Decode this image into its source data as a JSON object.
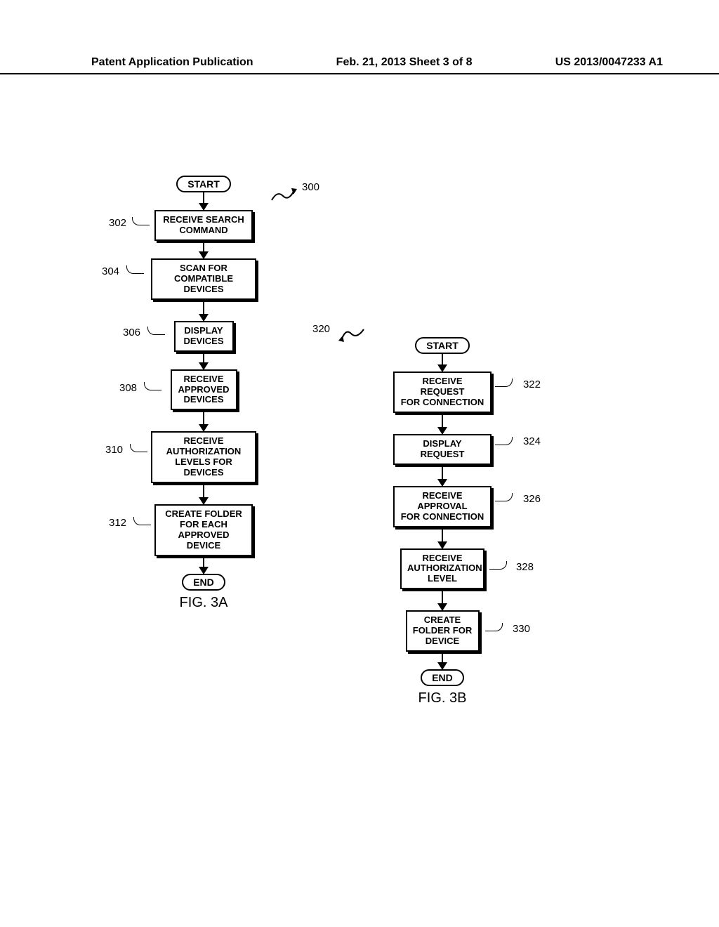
{
  "header": {
    "left": "Patent Application Publication",
    "center": "Feb. 21, 2013  Sheet 3 of 8",
    "right": "US 2013/0047233 A1"
  },
  "flowchartA": {
    "ref": "300",
    "start": "START",
    "steps": [
      {
        "ref": "302",
        "text": "RECEIVE SEARCH\nCOMMAND"
      },
      {
        "ref": "304",
        "text": "SCAN FOR\nCOMPATIBLE DEVICES"
      },
      {
        "ref": "306",
        "text": "DISPLAY\nDEVICES"
      },
      {
        "ref": "308",
        "text": "RECEIVE\nAPPROVED\nDEVICES"
      },
      {
        "ref": "310",
        "text": "RECEIVE\nAUTHORIZATION\nLEVELS FOR DEVICES"
      },
      {
        "ref": "312",
        "text": "CREATE FOLDER\nFOR EACH\nAPPROVED DEVICE"
      }
    ],
    "end": "END",
    "caption": "FIG. 3A"
  },
  "flowchartB": {
    "ref": "320",
    "start": "START",
    "steps": [
      {
        "ref": "322",
        "text": "RECEIVE REQUEST\nFOR CONNECTION"
      },
      {
        "ref": "324",
        "text": "DISPLAY REQUEST"
      },
      {
        "ref": "326",
        "text": "RECEIVE APPROVAL\nFOR CONNECTION"
      },
      {
        "ref": "328",
        "text": "RECEIVE\nAUTHORIZATION\nLEVEL"
      },
      {
        "ref": "330",
        "text": "CREATE\nFOLDER FOR\nDEVICE"
      }
    ],
    "end": "END",
    "caption": "FIG. 3B"
  }
}
